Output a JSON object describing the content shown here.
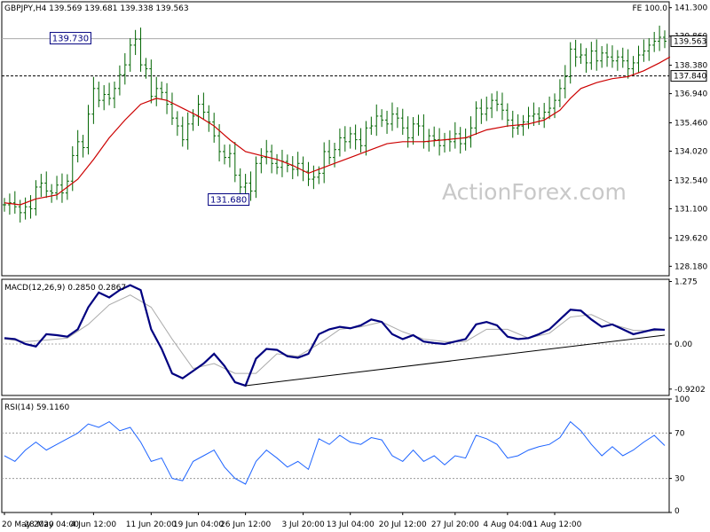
{
  "chart_data": [
    {
      "type": "candlestick",
      "panel": "price",
      "title": "GBPJPY,H4",
      "ohlc_readout": {
        "open": "139.569",
        "high": "139.681",
        "low": "139.338",
        "close": "139.563"
      },
      "corner_label": "FE 100.0",
      "watermark": "ActionForex.com",
      "ylim": [
        127.7,
        141.6
      ],
      "y_ticks": [
        "141.300",
        "139.860",
        "138.380",
        "136.940",
        "135.460",
        "134.020",
        "132.540",
        "131.100",
        "129.620",
        "128.180"
      ],
      "current_price_label": "139.563",
      "price_tag_level": "137.840",
      "level_lines": [
        {
          "value": 139.73,
          "style": "solid",
          "color": "#aaaaaa"
        },
        {
          "value": 137.84,
          "style": "dashed",
          "color": "#000000"
        }
      ],
      "annotations": [
        {
          "label": "139.730",
          "x": 16.5,
          "y": 139.73
        },
        {
          "label": "131.680",
          "x": 46,
          "y": 131.68
        }
      ],
      "bar_color": "#006400",
      "ma_color": "#cc0000",
      "close_series": [
        [
          0,
          131.3
        ],
        [
          1,
          131.4
        ],
        [
          2,
          131.2
        ],
        [
          3,
          130.9
        ],
        [
          4,
          131.2
        ],
        [
          5,
          131.1
        ],
        [
          6,
          132.2
        ],
        [
          7,
          132.4
        ],
        [
          8,
          132.0
        ],
        [
          9,
          131.9
        ],
        [
          10,
          132.3
        ],
        [
          11,
          131.9
        ],
        [
          12,
          132.5
        ],
        [
          13,
          133.8
        ],
        [
          14,
          134.5
        ],
        [
          15,
          134.2
        ],
        [
          16,
          135.9
        ],
        [
          17,
          137.2
        ],
        [
          18,
          136.6
        ],
        [
          19,
          136.9
        ],
        [
          20,
          136.7
        ],
        [
          21,
          137.2
        ],
        [
          22,
          137.9
        ],
        [
          23,
          138.4
        ],
        [
          24,
          139.4
        ],
        [
          25,
          139.7
        ],
        [
          26,
          138.4
        ],
        [
          27,
          138.2
        ],
        [
          28,
          136.8
        ],
        [
          29,
          137.2
        ],
        [
          30,
          137.0
        ],
        [
          31,
          136.4
        ],
        [
          32,
          135.7
        ],
        [
          33,
          135.3
        ],
        [
          34,
          134.6
        ],
        [
          35,
          135.4
        ],
        [
          36,
          135.8
        ],
        [
          37,
          136.4
        ],
        [
          38,
          136.0
        ],
        [
          39,
          135.5
        ],
        [
          40,
          134.8
        ],
        [
          41,
          134.0
        ],
        [
          42,
          133.7
        ],
        [
          43,
          133.9
        ],
        [
          44,
          132.8
        ],
        [
          45,
          132.2
        ],
        [
          46,
          132.4
        ],
        [
          47,
          132.0
        ],
        [
          48,
          133.4
        ],
        [
          49,
          133.7
        ],
        [
          50,
          134.0
        ],
        [
          51,
          133.4
        ],
        [
          52,
          133.2
        ],
        [
          53,
          133.5
        ],
        [
          54,
          133.3
        ],
        [
          55,
          133.1
        ],
        [
          56,
          133.4
        ],
        [
          57,
          133.0
        ],
        [
          58,
          132.6
        ],
        [
          59,
          132.7
        ],
        [
          60,
          132.9
        ],
        [
          61,
          134.0
        ],
        [
          62,
          133.7
        ],
        [
          63,
          134.1
        ],
        [
          64,
          134.7
        ],
        [
          65,
          134.5
        ],
        [
          66,
          134.9
        ],
        [
          67,
          134.6
        ],
        [
          68,
          134.3
        ],
        [
          69,
          135.2
        ],
        [
          70,
          135.3
        ],
        [
          71,
          135.8
        ],
        [
          72,
          135.6
        ],
        [
          73,
          135.4
        ],
        [
          74,
          135.9
        ],
        [
          75,
          135.7
        ],
        [
          76,
          135.2
        ],
        [
          77,
          134.7
        ],
        [
          78,
          135.4
        ],
        [
          79,
          135.3
        ],
        [
          80,
          134.5
        ],
        [
          81,
          134.8
        ],
        [
          82,
          134.6
        ],
        [
          83,
          134.3
        ],
        [
          84,
          134.6
        ],
        [
          85,
          134.5
        ],
        [
          86,
          134.9
        ],
        [
          87,
          134.4
        ],
        [
          88,
          134.7
        ],
        [
          89,
          135.2
        ],
        [
          90,
          136.2
        ],
        [
          91,
          135.9
        ],
        [
          92,
          136.2
        ],
        [
          93,
          136.6
        ],
        [
          94,
          136.4
        ],
        [
          95,
          136.1
        ],
        [
          96,
          135.6
        ],
        [
          97,
          135.2
        ],
        [
          98,
          135.3
        ],
        [
          99,
          135.5
        ],
        [
          100,
          135.8
        ],
        [
          101,
          135.9
        ],
        [
          102,
          135.7
        ],
        [
          103,
          136.0
        ],
        [
          104,
          136.2
        ],
        [
          105,
          136.6
        ],
        [
          106,
          137.2
        ],
        [
          107,
          137.8
        ],
        [
          108,
          139.2
        ],
        [
          109,
          138.8
        ],
        [
          110,
          138.9
        ],
        [
          111,
          138.5
        ],
        [
          112,
          139.1
        ],
        [
          113,
          138.6
        ],
        [
          114,
          139.0
        ],
        [
          115,
          138.8
        ],
        [
          116,
          138.6
        ],
        [
          117,
          138.8
        ],
        [
          118,
          138.6
        ],
        [
          119,
          138.2
        ],
        [
          120,
          138.5
        ],
        [
          121,
          138.9
        ],
        [
          122,
          139.1
        ],
        [
          123,
          139.4
        ],
        [
          124,
          139.6
        ],
        [
          125,
          139.8
        ],
        [
          126,
          139.6
        ]
      ],
      "ma_series": [
        [
          0,
          131.4
        ],
        [
          3,
          131.3
        ],
        [
          6,
          131.6
        ],
        [
          10,
          131.8
        ],
        [
          14,
          132.6
        ],
        [
          17,
          133.6
        ],
        [
          20,
          134.7
        ],
        [
          23,
          135.6
        ],
        [
          26,
          136.4
        ],
        [
          29,
          136.7
        ],
        [
          31,
          136.6
        ],
        [
          34,
          136.2
        ],
        [
          37,
          135.8
        ],
        [
          40,
          135.3
        ],
        [
          43,
          134.6
        ],
        [
          46,
          134.0
        ],
        [
          49,
          133.8
        ],
        [
          52,
          133.6
        ],
        [
          55,
          133.3
        ],
        [
          58,
          132.9
        ],
        [
          61,
          133.2
        ],
        [
          64,
          133.5
        ],
        [
          67,
          133.8
        ],
        [
          70,
          134.1
        ],
        [
          73,
          134.4
        ],
        [
          76,
          134.5
        ],
        [
          80,
          134.5
        ],
        [
          84,
          134.6
        ],
        [
          88,
          134.7
        ],
        [
          92,
          135.1
        ],
        [
          96,
          135.3
        ],
        [
          100,
          135.4
        ],
        [
          103,
          135.6
        ],
        [
          106,
          136.1
        ],
        [
          108,
          136.7
        ],
        [
          110,
          137.2
        ],
        [
          113,
          137.5
        ],
        [
          116,
          137.7
        ],
        [
          119,
          137.8
        ],
        [
          122,
          138.1
        ],
        [
          125,
          138.5
        ],
        [
          127,
          138.8
        ]
      ]
    },
    {
      "type": "line",
      "panel": "macd",
      "title": "MACD(12,26,9) 0.2850 0.2867",
      "ylim": [
        -1.05,
        1.32
      ],
      "y_ticks": [
        "1.275",
        "0.00",
        "-0.9202"
      ],
      "zero_line": 0.0,
      "macd_color": "#000080",
      "signal_color": "#aaaaaa",
      "macd_series": [
        [
          0,
          0.12
        ],
        [
          2,
          0.1
        ],
        [
          4,
          0.0
        ],
        [
          6,
          -0.05
        ],
        [
          8,
          0.2
        ],
        [
          10,
          0.18
        ],
        [
          12,
          0.15
        ],
        [
          14,
          0.3
        ],
        [
          16,
          0.75
        ],
        [
          18,
          1.05
        ],
        [
          20,
          0.95
        ],
        [
          22,
          1.1
        ],
        [
          24,
          1.2
        ],
        [
          26,
          1.1
        ],
        [
          28,
          0.3
        ],
        [
          30,
          -0.1
        ],
        [
          32,
          -0.6
        ],
        [
          34,
          -0.7
        ],
        [
          36,
          -0.55
        ],
        [
          38,
          -0.4
        ],
        [
          40,
          -0.2
        ],
        [
          42,
          -0.45
        ],
        [
          44,
          -0.78
        ],
        [
          46,
          -0.85
        ],
        [
          48,
          -0.3
        ],
        [
          50,
          -0.1
        ],
        [
          52,
          -0.12
        ],
        [
          54,
          -0.25
        ],
        [
          56,
          -0.28
        ],
        [
          58,
          -0.2
        ],
        [
          60,
          0.2
        ],
        [
          62,
          0.3
        ],
        [
          64,
          0.35
        ],
        [
          66,
          0.32
        ],
        [
          68,
          0.38
        ],
        [
          70,
          0.5
        ],
        [
          72,
          0.45
        ],
        [
          74,
          0.2
        ],
        [
          76,
          0.1
        ],
        [
          78,
          0.18
        ],
        [
          80,
          0.05
        ],
        [
          82,
          0.02
        ],
        [
          84,
          0.0
        ],
        [
          86,
          0.05
        ],
        [
          88,
          0.1
        ],
        [
          90,
          0.4
        ],
        [
          92,
          0.45
        ],
        [
          94,
          0.38
        ],
        [
          96,
          0.15
        ],
        [
          98,
          0.1
        ],
        [
          100,
          0.12
        ],
        [
          102,
          0.2
        ],
        [
          104,
          0.3
        ],
        [
          106,
          0.5
        ],
        [
          108,
          0.7
        ],
        [
          110,
          0.68
        ],
        [
          112,
          0.5
        ],
        [
          114,
          0.35
        ],
        [
          116,
          0.4
        ],
        [
          118,
          0.3
        ],
        [
          120,
          0.2
        ],
        [
          122,
          0.25
        ],
        [
          124,
          0.3
        ],
        [
          126,
          0.29
        ]
      ],
      "signal_series": [
        [
          0,
          0.1
        ],
        [
          4,
          0.05
        ],
        [
          8,
          0.08
        ],
        [
          12,
          0.12
        ],
        [
          16,
          0.4
        ],
        [
          20,
          0.8
        ],
        [
          24,
          1.0
        ],
        [
          28,
          0.75
        ],
        [
          32,
          0.1
        ],
        [
          36,
          -0.5
        ],
        [
          40,
          -0.4
        ],
        [
          44,
          -0.6
        ],
        [
          48,
          -0.6
        ],
        [
          52,
          -0.2
        ],
        [
          56,
          -0.25
        ],
        [
          60,
          0.0
        ],
        [
          64,
          0.3
        ],
        [
          68,
          0.35
        ],
        [
          72,
          0.45
        ],
        [
          76,
          0.25
        ],
        [
          80,
          0.1
        ],
        [
          84,
          0.05
        ],
        [
          88,
          0.05
        ],
        [
          92,
          0.3
        ],
        [
          96,
          0.3
        ],
        [
          100,
          0.12
        ],
        [
          104,
          0.22
        ],
        [
          108,
          0.55
        ],
        [
          112,
          0.6
        ],
        [
          116,
          0.4
        ],
        [
          120,
          0.28
        ],
        [
          124,
          0.27
        ],
        [
          126,
          0.29
        ]
      ],
      "trendline": [
        [
          46,
          -0.85
        ],
        [
          126,
          0.18
        ]
      ]
    },
    {
      "type": "line",
      "panel": "rsi",
      "title": "RSI(14) 59.1160",
      "ylim": [
        0,
        100
      ],
      "y_ticks": [
        "100",
        "70",
        "30",
        "0"
      ],
      "levels": [
        70,
        30
      ],
      "line_color": "#1e64ff",
      "rsi_series": [
        [
          0,
          50
        ],
        [
          2,
          45
        ],
        [
          4,
          55
        ],
        [
          6,
          62
        ],
        [
          8,
          55
        ],
        [
          10,
          60
        ],
        [
          12,
          65
        ],
        [
          14,
          70
        ],
        [
          16,
          78
        ],
        [
          18,
          75
        ],
        [
          20,
          80
        ],
        [
          22,
          72
        ],
        [
          24,
          75
        ],
        [
          26,
          62
        ],
        [
          28,
          45
        ],
        [
          30,
          48
        ],
        [
          32,
          30
        ],
        [
          34,
          28
        ],
        [
          36,
          45
        ],
        [
          38,
          50
        ],
        [
          40,
          55
        ],
        [
          42,
          40
        ],
        [
          44,
          30
        ],
        [
          46,
          25
        ],
        [
          48,
          45
        ],
        [
          50,
          55
        ],
        [
          52,
          48
        ],
        [
          54,
          40
        ],
        [
          56,
          45
        ],
        [
          58,
          38
        ],
        [
          60,
          65
        ],
        [
          62,
          60
        ],
        [
          64,
          68
        ],
        [
          66,
          62
        ],
        [
          68,
          60
        ],
        [
          70,
          66
        ],
        [
          72,
          64
        ],
        [
          74,
          50
        ],
        [
          76,
          45
        ],
        [
          78,
          55
        ],
        [
          80,
          45
        ],
        [
          82,
          50
        ],
        [
          84,
          42
        ],
        [
          86,
          50
        ],
        [
          88,
          48
        ],
        [
          90,
          68
        ],
        [
          92,
          65
        ],
        [
          94,
          60
        ],
        [
          96,
          48
        ],
        [
          98,
          50
        ],
        [
          100,
          55
        ],
        [
          102,
          58
        ],
        [
          104,
          60
        ],
        [
          106,
          66
        ],
        [
          108,
          80
        ],
        [
          110,
          72
        ],
        [
          112,
          60
        ],
        [
          114,
          50
        ],
        [
          116,
          58
        ],
        [
          118,
          50
        ],
        [
          120,
          55
        ],
        [
          122,
          62
        ],
        [
          124,
          68
        ],
        [
          126,
          59
        ]
      ]
    }
  ],
  "x_axis": {
    "labels": [
      {
        "text": "20 May 2020",
        "x": 0
      },
      {
        "text": "28 May 04:00",
        "x": 9
      },
      {
        "text": "4 Jun 12:00",
        "x": 17
      },
      {
        "text": "11 Jun 20:00",
        "x": 28
      },
      {
        "text": "19 Jun 04:00",
        "x": 37
      },
      {
        "text": "26 Jun 12:00",
        "x": 46
      },
      {
        "text": "3 Jul 20:00",
        "x": 57
      },
      {
        "text": "13 Jul 04:00",
        "x": 66
      },
      {
        "text": "20 Jul 12:00",
        "x": 76
      },
      {
        "text": "27 Jul 20:00",
        "x": 86
      },
      {
        "text": "4 Aug 04:00",
        "x": 96
      },
      {
        "text": "11 Aug 12:00",
        "x": 105
      }
    ]
  },
  "colors": {
    "background": "#ffffff",
    "frame": "#000000",
    "grid": "#e0e0e0"
  }
}
